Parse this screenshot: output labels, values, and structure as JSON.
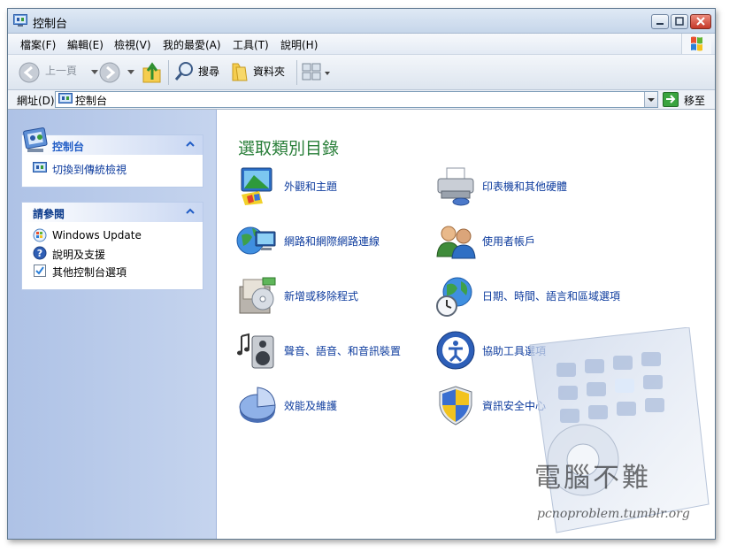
{
  "window": {
    "title": "控制台"
  },
  "menu": [
    "檔案(F)",
    "編輯(E)",
    "檢視(V)",
    "我的最愛(A)",
    "工具(T)",
    "說明(H)"
  ],
  "toolbar": {
    "back_label": "上一頁",
    "search_label": "搜尋",
    "folders_label": "資料夾"
  },
  "address": {
    "label": "網址(D)",
    "value": "控制台",
    "go_label": "移至"
  },
  "sidebar": {
    "control_panel": {
      "title": "控制台",
      "links": [
        "切換到傳統檢視"
      ]
    },
    "see_also": {
      "title": "請參閱",
      "links": [
        "Windows Update",
        "說明及支援",
        "其他控制台選項"
      ]
    }
  },
  "content": {
    "title": "選取類別目錄",
    "categories": [
      "外觀和主題",
      "印表機和其他硬體",
      "網路和網際網路連線",
      "使用者帳戶",
      "新增或移除程式",
      "日期、時間、語言和區域選項",
      "聲音、語音、和音訊裝置",
      "協助工具選項",
      "效能及維護",
      "資訊安全中心"
    ]
  },
  "watermark": {
    "text": "電腦不難",
    "sub": "pcnoproblem.tumblr.org"
  },
  "colors": {
    "link": "#0e3c9e",
    "heading": "#2a7f3a",
    "panel_title": "#215dc6"
  }
}
